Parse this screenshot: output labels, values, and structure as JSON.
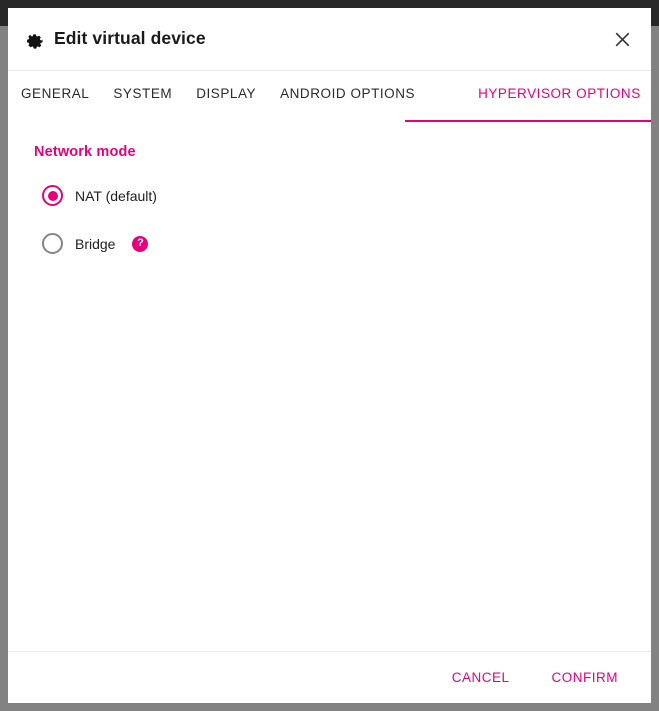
{
  "window": {
    "title": "Edit virtual device",
    "title_icon": "gear-icon",
    "close_icon": "close-icon"
  },
  "tabs": [
    {
      "id": "general",
      "label": "GENERAL",
      "active": false
    },
    {
      "id": "system",
      "label": "SYSTEM",
      "active": false
    },
    {
      "id": "display",
      "label": "DISPLAY",
      "active": false
    },
    {
      "id": "android",
      "label": "ANDROID OPTIONS",
      "active": false
    },
    {
      "id": "hypervisor",
      "label": "HYPERVISOR OPTIONS",
      "active": true
    }
  ],
  "content": {
    "section_title": "Network mode",
    "options": [
      {
        "id": "nat",
        "label": "NAT (default)",
        "selected": true,
        "help": false
      },
      {
        "id": "bridge",
        "label": "Bridge",
        "selected": false,
        "help": true,
        "help_icon": "help-icon",
        "help_glyph": "?"
      }
    ]
  },
  "footer": {
    "cancel_label": "CANCEL",
    "confirm_label": "CONFIRM"
  },
  "colors": {
    "accent": "#e6007e",
    "dialog_background": "#ffffff",
    "window_border": "#828282",
    "titlebar_strip": "#282828",
    "text": "#202020",
    "radio_unchecked_border": "#858585",
    "divider": "#ececec"
  }
}
